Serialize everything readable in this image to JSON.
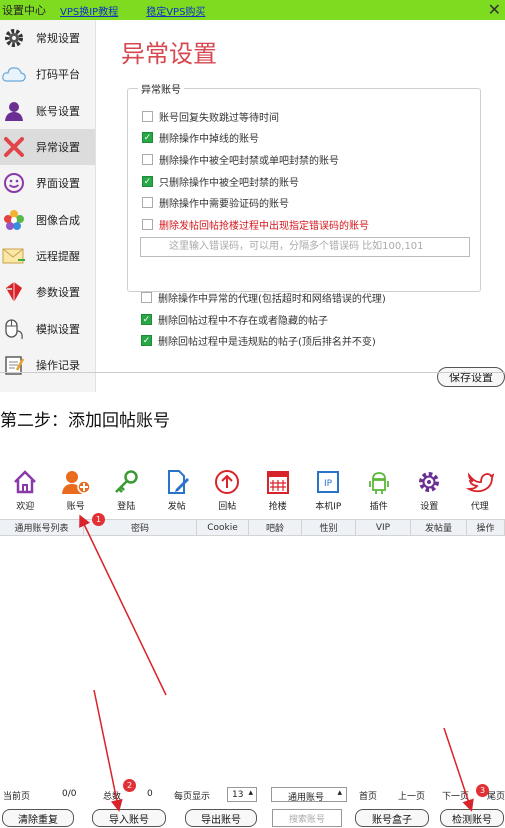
{
  "settings_window": {
    "title": "设置中心",
    "link1": "VPS换IP教程",
    "link2": "稳定VPS购买",
    "close": "✕",
    "sidebar": [
      {
        "label": "常规设置",
        "icon": "gear-icon"
      },
      {
        "label": "打码平台",
        "icon": "cloud-icon"
      },
      {
        "label": "账号设置",
        "icon": "user-icon"
      },
      {
        "label": "异常设置",
        "icon": "red-x-icon"
      },
      {
        "label": "界面设置",
        "icon": "smiley-icon"
      },
      {
        "label": "图像合成",
        "icon": "flower-icon"
      },
      {
        "label": "远程提醒",
        "icon": "envelope-icon"
      },
      {
        "label": "参数设置",
        "icon": "cube-icon"
      },
      {
        "label": "模拟设置",
        "icon": "mouse-icon"
      },
      {
        "label": "操作记录",
        "icon": "notepad-icon"
      }
    ],
    "active_index": 3,
    "page_title": "异常设置",
    "group_legend": "异常账号",
    "group_options": [
      {
        "label": "账号回复失败跳过等待时间",
        "checked": false,
        "color": "normal"
      },
      {
        "label": "删除操作中掉线的账号",
        "checked": true,
        "color": "normal"
      },
      {
        "label": "删除操作中被全吧封禁或单吧封禁的账号",
        "checked": false,
        "color": "normal"
      },
      {
        "label": "只删除操作中被全吧封禁的账号",
        "checked": true,
        "color": "normal"
      },
      {
        "label": "删除操作中需要验证码的账号",
        "checked": false,
        "color": "normal"
      },
      {
        "label": "删除发帖回帖抢楼过程中出现指定错误码的账号",
        "checked": false,
        "color": "red"
      }
    ],
    "error_placeholder": "这里输入错误码，可以用，分隔多个错误码   比如100,101",
    "extra_options": [
      {
        "label": "删除操作中异常的代理(包括超时和网络错误的代理)",
        "checked": false,
        "color": "normal"
      },
      {
        "label": "删除回帖过程中不存在或者隐藏的帖子",
        "checked": true,
        "color": "normal"
      },
      {
        "label": "删除回帖过程中是违规贴的帖子(顶后排名并不变)",
        "checked": true,
        "color": "blue"
      }
    ],
    "save_label": "保存设置"
  },
  "step_text": "第二步：添加回帖账号",
  "client": {
    "toolbar": [
      {
        "label": "欢迎",
        "icon": "home-icon"
      },
      {
        "label": "账号",
        "icon": "add-user-icon"
      },
      {
        "label": "登陆",
        "icon": "key-icon"
      },
      {
        "label": "发帖",
        "icon": "document-edit-icon"
      },
      {
        "label": "回帖",
        "icon": "upload-circle-icon"
      },
      {
        "label": "抢楼",
        "icon": "calendar-grid-icon"
      },
      {
        "label": "本机IP",
        "icon": "ip-icon"
      },
      {
        "label": "插件",
        "icon": "android-icon"
      },
      {
        "label": "设置",
        "icon": "settings-gear-icon"
      },
      {
        "label": "代理",
        "icon": "bird-icon"
      }
    ],
    "columns": [
      "通用账号列表",
      "密码",
      "Cookie",
      "吧龄",
      "性别",
      "VIP",
      "发帖量",
      "操作"
    ],
    "pager": {
      "current_label": "当前页",
      "current_value": "0/0",
      "total_label": "总数",
      "total_value": "0",
      "per_page_label": "每页显示",
      "per_page_value": "13",
      "account_type": "通用账号",
      "first": "首页",
      "prev": "上一页",
      "next": "下一页",
      "last": "尾页"
    },
    "buttons": {
      "clear": "清除重复",
      "import": "导入账号",
      "export": "导出账号",
      "search_placeholder": "搜索账号",
      "box": "账号盒子",
      "check": "检测账号"
    },
    "badges": [
      "1",
      "2",
      "3"
    ]
  }
}
